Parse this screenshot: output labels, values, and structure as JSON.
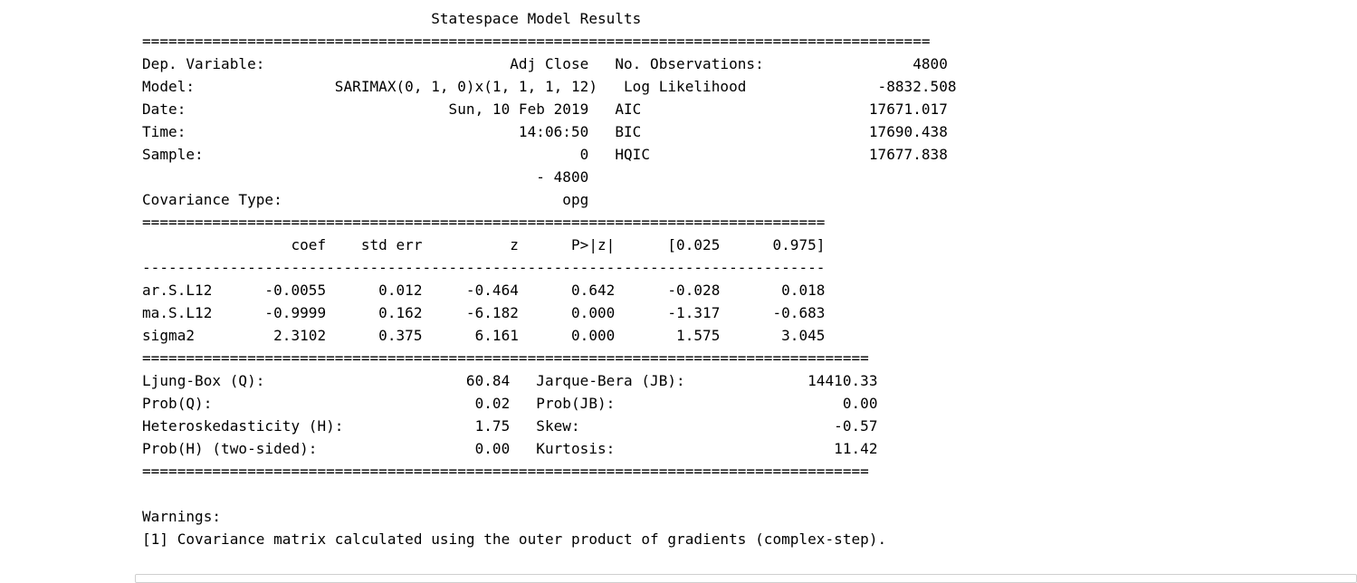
{
  "output_lines": [
    "                                 Statespace Model Results                                 ",
    "==========================================================================================",
    "Dep. Variable:                            Adj Close   No. Observations:                 4800",
    "Model:                SARIMAX(0, 1, 0)x(1, 1, 1, 12)   Log Likelihood               -8832.508",
    "Date:                              Sun, 10 Feb 2019   AIC                          17671.017",
    "Time:                                      14:06:50   BIC                          17690.438",
    "Sample:                                           0   HQIC                         17677.838",
    "                                             - 4800                                       ",
    "Covariance Type:                                opg                                       ",
    "==============================================================================",
    "                 coef    std err          z      P>|z|      [0.025      0.975]",
    "------------------------------------------------------------------------------",
    "ar.S.L12      -0.0055      0.012     -0.464      0.642      -0.028       0.018",
    "ma.S.L12      -0.9999      0.162     -6.182      0.000      -1.317      -0.683",
    "sigma2         2.3102      0.375      6.161      0.000       1.575       3.045",
    "===================================================================================",
    "Ljung-Box (Q):                       60.84   Jarque-Bera (JB):              14410.33",
    "Prob(Q):                              0.02   Prob(JB):                          0.00",
    "Heteroskedasticity (H):               1.75   Skew:                             -0.57",
    "Prob(H) (two-sided):                  0.00   Kurtosis:                         11.42",
    "===================================================================================",
    "",
    "Warnings:",
    "[1] Covariance matrix calculated using the outer product of gradients (complex-step)."
  ]
}
